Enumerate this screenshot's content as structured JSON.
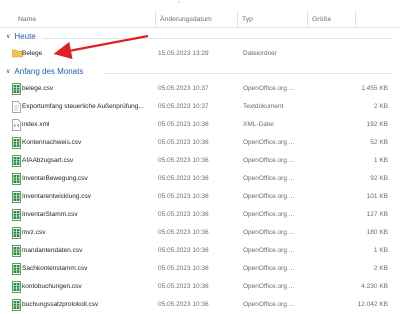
{
  "columns": {
    "name": "Name",
    "date": "Änderungsdatum",
    "type": "Typ",
    "size": "Größe"
  },
  "groups": {
    "today": "Heute",
    "month": "Anfang des Monats"
  },
  "today_items": [
    {
      "name": "Belege",
      "date": "15.05.2023 13:29",
      "type": "Dateiordner",
      "size": "",
      "icon": "folder-icon"
    }
  ],
  "month_items": [
    {
      "name": "belege.csv",
      "date": "05.05.2023 10:37",
      "type": "OpenOffice.org ...",
      "size": "1.455 KB",
      "icon": "spreadsheet-icon"
    },
    {
      "name": "Exportumfang steuerliche Außenprüfung...",
      "date": "05.05.2023 10:37",
      "type": "Textdokument",
      "size": "2 KB",
      "icon": "text-document-icon"
    },
    {
      "name": "index.xml",
      "date": "05.05.2023 10:36",
      "type": "XML-Datei",
      "size": "192 KB",
      "icon": "xml-file-icon"
    },
    {
      "name": "Kontennachweis.csv",
      "date": "05.05.2023 10:36",
      "type": "OpenOffice.org ...",
      "size": "52 KB",
      "icon": "spreadsheet-icon"
    },
    {
      "name": "AfAAbzugsart.csv",
      "date": "05.05.2023 10:36",
      "type": "OpenOffice.org ...",
      "size": "1 KB",
      "icon": "spreadsheet-icon"
    },
    {
      "name": "InventarBewegung.csv",
      "date": "05.05.2023 10:36",
      "type": "OpenOffice.org ...",
      "size": "92 KB",
      "icon": "spreadsheet-icon"
    },
    {
      "name": "Inventarentwicklung.csv",
      "date": "05.05.2023 10:36",
      "type": "OpenOffice.org ...",
      "size": "101 KB",
      "icon": "spreadsheet-icon"
    },
    {
      "name": "InventarStamm.csv",
      "date": "05.05.2023 10:36",
      "type": "OpenOffice.org ...",
      "size": "127 KB",
      "icon": "spreadsheet-icon"
    },
    {
      "name": "mvz.csv",
      "date": "05.05.2023 10:36",
      "type": "OpenOffice.org ...",
      "size": "180 KB",
      "icon": "spreadsheet-icon"
    },
    {
      "name": "mandantendaten.csv",
      "date": "05.05.2023 10:36",
      "type": "OpenOffice.org ...",
      "size": "1 KB",
      "icon": "spreadsheet-icon"
    },
    {
      "name": "Sachkontenstamm.csv",
      "date": "05.05.2023 10:36",
      "type": "OpenOffice.org ...",
      "size": "2 KB",
      "icon": "spreadsheet-icon"
    },
    {
      "name": "kontobuchungen.csv",
      "date": "05.05.2023 10:36",
      "type": "OpenOffice.org ...",
      "size": "4.230 KB",
      "icon": "spreadsheet-icon"
    },
    {
      "name": "buchungssatzprotokoll.csv",
      "date": "05.05.2023 10:36",
      "type": "OpenOffice.org ...",
      "size": "12.042 KB",
      "icon": "spreadsheet-icon"
    }
  ],
  "colors": {
    "group_text": "#1a5fb4",
    "annotation_arrow": "#e02020",
    "spreadsheet_icon": "#2e8b3a",
    "folder_icon": "#f2c14e"
  }
}
